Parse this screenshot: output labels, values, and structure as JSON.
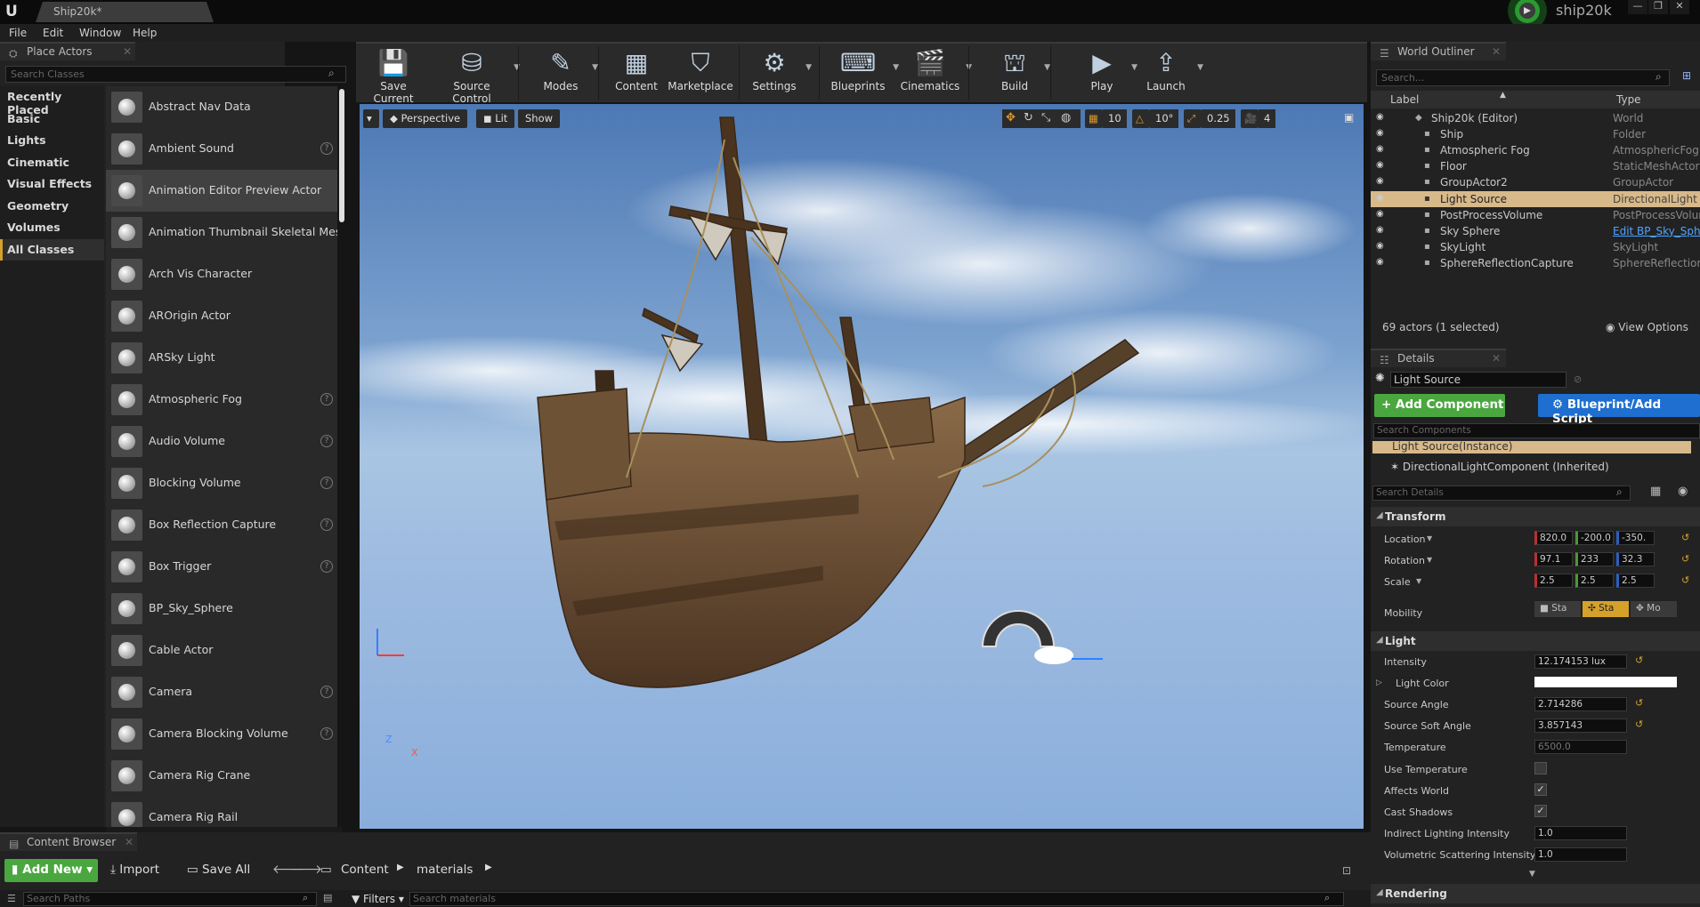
{
  "window": {
    "tab_title": "Ship20k*",
    "project_name": "ship20k"
  },
  "menu": [
    "File",
    "Edit",
    "Window",
    "Help"
  ],
  "place_actors": {
    "tab_label": "Place Actors",
    "search_placeholder": "Search Classes",
    "categories": [
      "Recently Placed",
      "Basic",
      "Lights",
      "Cinematic",
      "Visual Effects",
      "Geometry",
      "Volumes",
      "All Classes"
    ],
    "selected_category": "All Classes",
    "actors": [
      {
        "label": "Abstract Nav Data",
        "help": false
      },
      {
        "label": "Ambient Sound",
        "help": true
      },
      {
        "label": "Animation Editor Preview Actor",
        "help": false
      },
      {
        "label": "Animation Thumbnail Skeletal Mesh",
        "help": false
      },
      {
        "label": "Arch Vis Character",
        "help": false
      },
      {
        "label": "AROrigin Actor",
        "help": false
      },
      {
        "label": "ARSky Light",
        "help": false
      },
      {
        "label": "Atmospheric Fog",
        "help": true
      },
      {
        "label": "Audio Volume",
        "help": true
      },
      {
        "label": "Blocking Volume",
        "help": true
      },
      {
        "label": "Box Reflection Capture",
        "help": true
      },
      {
        "label": "Box Trigger",
        "help": true
      },
      {
        "label": "BP_Sky_Sphere",
        "help": false
      },
      {
        "label": "Cable Actor",
        "help": false
      },
      {
        "label": "Camera",
        "help": true
      },
      {
        "label": "Camera Blocking Volume",
        "help": true
      },
      {
        "label": "Camera Rig Crane",
        "help": false
      },
      {
        "label": "Camera Rig Rail",
        "help": false
      }
    ],
    "selected_actor": "Animation Editor Preview Actor"
  },
  "toolbar": [
    {
      "label": "Save Current",
      "icon": "save-icon",
      "caret": false
    },
    {
      "label": "Source Control",
      "icon": "source-control-icon",
      "caret": true
    },
    {
      "label": "Modes",
      "icon": "modes-icon",
      "caret": true
    },
    {
      "label": "Content",
      "icon": "content-icon",
      "caret": false
    },
    {
      "label": "Marketplace",
      "icon": "marketplace-icon",
      "caret": false
    },
    {
      "label": "Settings",
      "icon": "settings-icon",
      "caret": true
    },
    {
      "label": "Blueprints",
      "icon": "blueprints-icon",
      "caret": true
    },
    {
      "label": "Cinematics",
      "icon": "cinematics-icon",
      "caret": true
    },
    {
      "label": "Build",
      "icon": "build-icon",
      "caret": true
    },
    {
      "label": "Play",
      "icon": "play-icon",
      "caret": true
    },
    {
      "label": "Launch",
      "icon": "launch-icon",
      "caret": true
    }
  ],
  "viewport": {
    "view_mode": "Perspective",
    "lighting": "Lit",
    "show": "Show",
    "grid_snap": "10",
    "rotation_snap": "10°",
    "scale_snap": "0.25",
    "camera_speed": "4",
    "axis_z": "Z",
    "axis_x": "X"
  },
  "world_outliner": {
    "tab_label": "World Outliner",
    "search_placeholder": "Search...",
    "col_label": "Label",
    "col_type": "Type",
    "rows": [
      {
        "label": "Ship20k (Editor)",
        "type": "World",
        "indent": 0,
        "selected": false
      },
      {
        "label": "Ship",
        "type": "Folder",
        "indent": 1,
        "selected": false
      },
      {
        "label": "Atmospheric Fog",
        "type": "AtmosphericFog",
        "indent": 1,
        "selected": false
      },
      {
        "label": "Floor",
        "type": "StaticMeshActor",
        "indent": 1,
        "selected": false
      },
      {
        "label": "GroupActor2",
        "type": "GroupActor",
        "indent": 1,
        "selected": false
      },
      {
        "label": "Light Source",
        "type": "DirectionalLight",
        "indent": 1,
        "selected": true
      },
      {
        "label": "PostProcessVolume",
        "type": "PostProcessVolum",
        "indent": 1,
        "selected": false
      },
      {
        "label": "Sky Sphere",
        "type": "Edit BP_Sky_Sph",
        "indent": 1,
        "selected": false
      },
      {
        "label": "SkyLight",
        "type": "SkyLight",
        "indent": 1,
        "selected": false
      },
      {
        "label": "SphereReflectionCapture",
        "type": "SphereReflectionC",
        "indent": 1,
        "selected": false
      }
    ],
    "actor_count": "69 actors (1 selected)",
    "view_options": "View Options"
  },
  "details": {
    "tab_label": "Details",
    "actor_name": "Light Source",
    "add_component": "+ Add Component",
    "blueprint_script": "Blueprint/Add Script",
    "search_components": "Search Components",
    "component_root": "Light Source(Instance)",
    "component_child": "DirectionalLightComponent (Inherited)",
    "search_details": "Search Details",
    "transform": {
      "header": "Transform",
      "location_label": "Location",
      "location": [
        "820.0",
        "-200.0",
        "-350."
      ],
      "rotation_label": "Rotation",
      "rotation": [
        "97.1",
        "233",
        "32.3"
      ],
      "scale_label": "Scale",
      "scale": [
        "2.5",
        "2.5",
        "2.5"
      ],
      "mobility_label": "Mobility",
      "mobility": [
        "Sta",
        "Sta",
        "Mo"
      ]
    },
    "light": {
      "header": "Light",
      "intensity_label": "Intensity",
      "intensity": "12.174153 lux",
      "light_color_label": "Light Color",
      "source_angle_label": "Source Angle",
      "source_angle": "2.714286",
      "source_soft_angle_label": "Source Soft Angle",
      "source_soft_angle": "3.857143",
      "temperature_label": "Temperature",
      "temperature": "6500.0",
      "use_temperature_label": "Use Temperature",
      "use_temperature": false,
      "affects_world_label": "Affects World",
      "affects_world": true,
      "cast_shadows_label": "Cast Shadows",
      "cast_shadows": true,
      "indirect_label": "Indirect Lighting Intensity",
      "indirect": "1.0",
      "volumetric_label": "Volumetric Scattering Intensity",
      "volumetric": "1.0"
    },
    "rendering_header": "Rendering"
  },
  "content_browser": {
    "tab_label": "Content Browser",
    "add_new": "Add New",
    "import": "Import",
    "save_all": "Save All",
    "path": [
      "Content",
      "materials"
    ],
    "search_paths": "Search Paths",
    "filters": "Filters",
    "search_materials": "Search materials"
  },
  "colors": {
    "accent": "#d4a12a",
    "add_green": "#4aa73f",
    "blueprint_blue": "#1e6fd0",
    "selected_row": "#d8b98a"
  }
}
